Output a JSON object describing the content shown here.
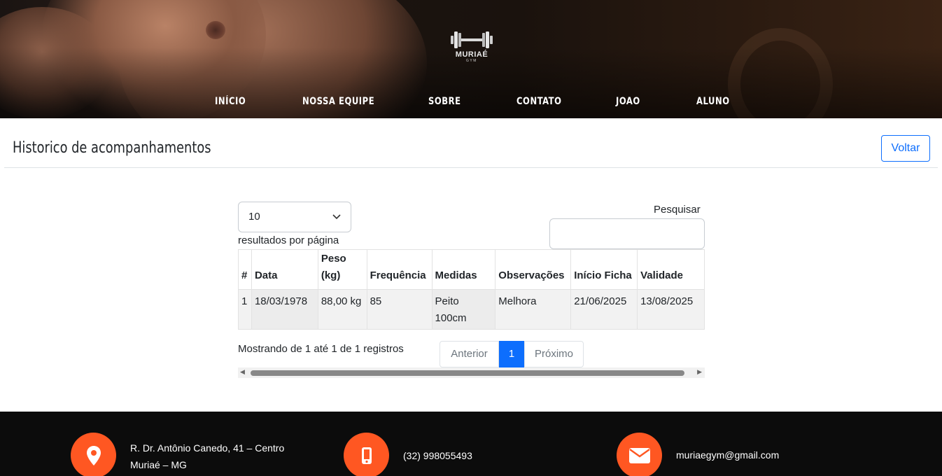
{
  "brand": {
    "name": "MURIAÉ",
    "sub": "GYM"
  },
  "nav": [
    "INÍCIO",
    "NOSSA EQUIPE",
    "SOBRE",
    "CONTATO",
    "JOAO",
    "ALUNO"
  ],
  "page": {
    "title": "Historico de acompanhamentos",
    "back_label": "Voltar"
  },
  "table_controls": {
    "page_length_value": "10",
    "page_length_label": "resultados por página",
    "search_label": "Pesquisar",
    "search_value": ""
  },
  "table": {
    "headers": [
      "#",
      "Data",
      "Peso (kg)",
      "Frequência",
      "Medidas",
      "Observações",
      "Início Ficha",
      "Validade"
    ],
    "rows": [
      [
        "1",
        "18/03/1978",
        "88,00 kg",
        "85",
        "Peito 100cm",
        "Melhora",
        "21/06/2025",
        "13/08/2025"
      ]
    ]
  },
  "pagination": {
    "info": "Mostrando de 1 até 1 de 1 registros",
    "prev": "Anterior",
    "current": "1",
    "next": "Próximo"
  },
  "footer": {
    "address_line1": "R. Dr. Antônio Canedo, 41 – Centro",
    "address_line2": "Muriaé – MG",
    "phone": "(32) 998055493",
    "email": "muriaegym@gmail.com",
    "accent_color": "#ff5722"
  }
}
